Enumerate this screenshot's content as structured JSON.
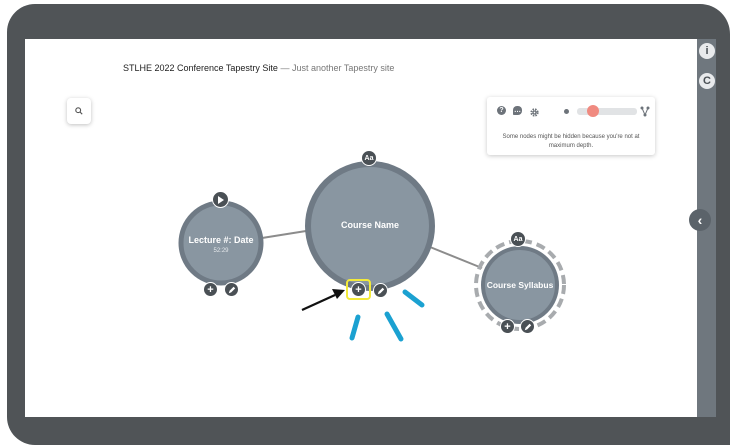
{
  "site": {
    "title": "STLHE 2022 Conference Tapestry Site",
    "separator": "—",
    "tagline": "Just another Tapestry site"
  },
  "controls": {
    "warning": "Some nodes might be hidden because you're not at maximum depth.",
    "depth_level": 0.2,
    "icons": [
      "help-icon",
      "comment-icon",
      "settings-icon",
      "fork-icon"
    ]
  },
  "side_buttons": {
    "info_label": "i",
    "refresh_label": "C",
    "collapse_label": "‹"
  },
  "nodes": {
    "lecture": {
      "title": "Lecture #: Date",
      "duration": "52:29"
    },
    "course_name": {
      "title": "Course Name",
      "badge": "Aa"
    },
    "syllabus": {
      "title": "Course Syllabus",
      "badge": "Aa"
    }
  },
  "colors": {
    "node_fill": "#8996a1",
    "node_border": "#6f7a85",
    "annotation_blue": "#1ba1d1",
    "highlight_yellow": "#f3ea3a",
    "slider_thumb": "#f08a80"
  }
}
